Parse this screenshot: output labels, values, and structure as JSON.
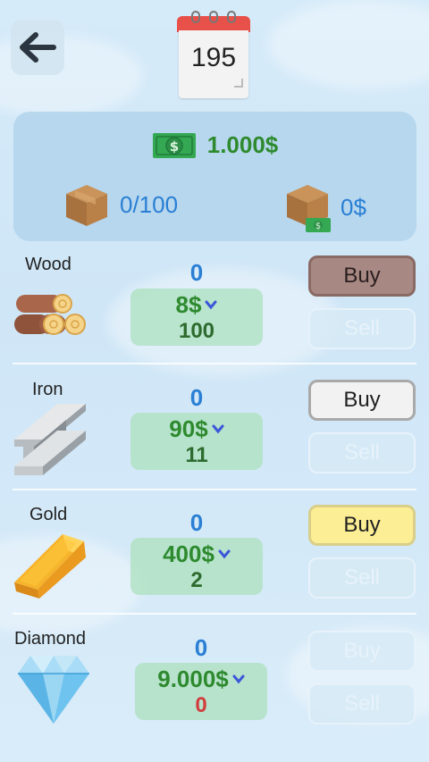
{
  "header": {
    "day": "195"
  },
  "stats": {
    "money": "1.000$",
    "storage": "0/100",
    "inventory_value": "0$"
  },
  "buttons": {
    "buy": "Buy",
    "sell": "Sell"
  },
  "items": [
    {
      "name": "Wood",
      "owned": "0",
      "price": "8$",
      "stock": "100"
    },
    {
      "name": "Iron",
      "owned": "0",
      "price": "90$",
      "stock": "11"
    },
    {
      "name": "Gold",
      "owned": "0",
      "price": "400$",
      "stock": "2"
    },
    {
      "name": "Diamond",
      "owned": "0",
      "price": "9.000$",
      "stock": "0"
    }
  ],
  "colors": {
    "money_green": "#2e8a2e",
    "stat_blue": "#2a7fd4",
    "out_of_stock_red": "#d23c3c",
    "buy_wood": "#a78882",
    "buy_gold": "#fbee94"
  }
}
